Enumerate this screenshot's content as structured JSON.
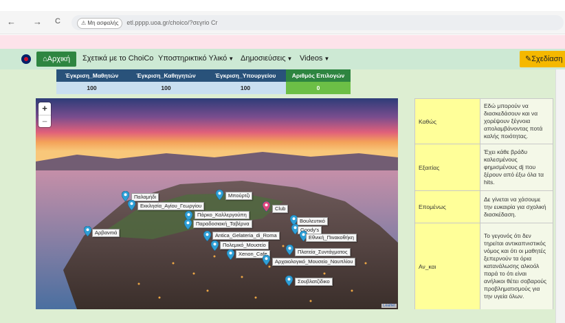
{
  "browser": {
    "back": "←",
    "forward": "→",
    "reload": "C",
    "insecure_label": "Μη ασφαλής",
    "url": "etl.pppp.uoa.gr/choico/?σεγrio Cr"
  },
  "nav": {
    "home": "Αρχική",
    "items": [
      {
        "label": "Σχετικά με το ChoiCo",
        "caret": false
      },
      {
        "label": "Υποστηρικτικό Υλικό",
        "caret": true
      },
      {
        "label": "Δημοσιεύσεις",
        "caret": true
      },
      {
        "label": "Videos",
        "caret": true
      }
    ],
    "design_button": "Σχεδίαση"
  },
  "approval": {
    "headers": [
      "Έγκριση_Μαθητών",
      "Έγκριση_Καθηγητών",
      "Έγκριση_Υπουργείου",
      "Αριθμός Επιλογών"
    ],
    "values": [
      "100",
      "100",
      "100",
      "0"
    ]
  },
  "map": {
    "zoom_in": "+",
    "zoom_out": "−",
    "attribution": "Leaflet",
    "pins": [
      {
        "label": "Παλαμήδι",
        "color": "#2e9fd6"
      },
      {
        "label": "Εκκλησία_Αγίου_Γεωργίου",
        "color": "#2e9fd6"
      },
      {
        "label": "Μπούρτζι",
        "color": "#2e9fd6"
      },
      {
        "label": "Club",
        "color": "#e0457b"
      },
      {
        "label": "Πάρκο_Καλλεργούπη",
        "color": "#2e9fd6"
      },
      {
        "label": "Παραδοσιακή_Ταβέρνα",
        "color": "#2e9fd6"
      },
      {
        "label": "Βουλευτικό",
        "color": "#2e9fd6"
      },
      {
        "label": "Goody's",
        "color": "#2e9fd6"
      },
      {
        "label": "Αρβανιτιά",
        "color": "#2e9fd6"
      },
      {
        "label": "Antica_Gelateria_di_Roma",
        "color": "#2e9fd6"
      },
      {
        "label": "Εθνική_Πινακοθήκη",
        "color": "#2e9fd6"
      },
      {
        "label": "Πολεμικό_Μουσείο",
        "color": "#2e9fd6"
      },
      {
        "label": "Πλατεία_Συντάγματος",
        "color": "#2e9fd6"
      },
      {
        "label": "Xenon_Cafe",
        "color": "#2e9fd6"
      },
      {
        "label": "Αρχαιολογικό_Μουσείο_Ναυπλίου",
        "color": "#2e9fd6"
      },
      {
        "label": "Σουβλατζίδικο",
        "color": "#2e9fd6"
      }
    ]
  },
  "side_panel": {
    "rows": [
      {
        "key": "Καθώς",
        "desc": "Εδώ μπορούν να διασκεδάσουν και να χορέψουν ξέγνοια απολαμβάνοντας ποτά καλής ποιότητας."
      },
      {
        "key": "Εξαιτίας",
        "desc": "Έχει κάθε βράδυ καλεσμένους φημισμένους dj που ξέρουν από έξω όλα τα hits."
      },
      {
        "key": "Επομένως",
        "desc": "Δε γίνεται να χάσουμε την ευκαιρία για σχολική διασκέδαση."
      },
      {
        "key": "Αν_και",
        "desc": "Το γεγονός ότι δεν τηρείται αντικαπνιστικός νόμος και ότι οι μαθητές ξεπερνούν τα όρια κατανάλωσης αλκοόλ παρά το ότι είναι ανήλικοι θέτει σοβαρούς προβληματισμούς για την υγεία όλων."
      }
    ]
  }
}
